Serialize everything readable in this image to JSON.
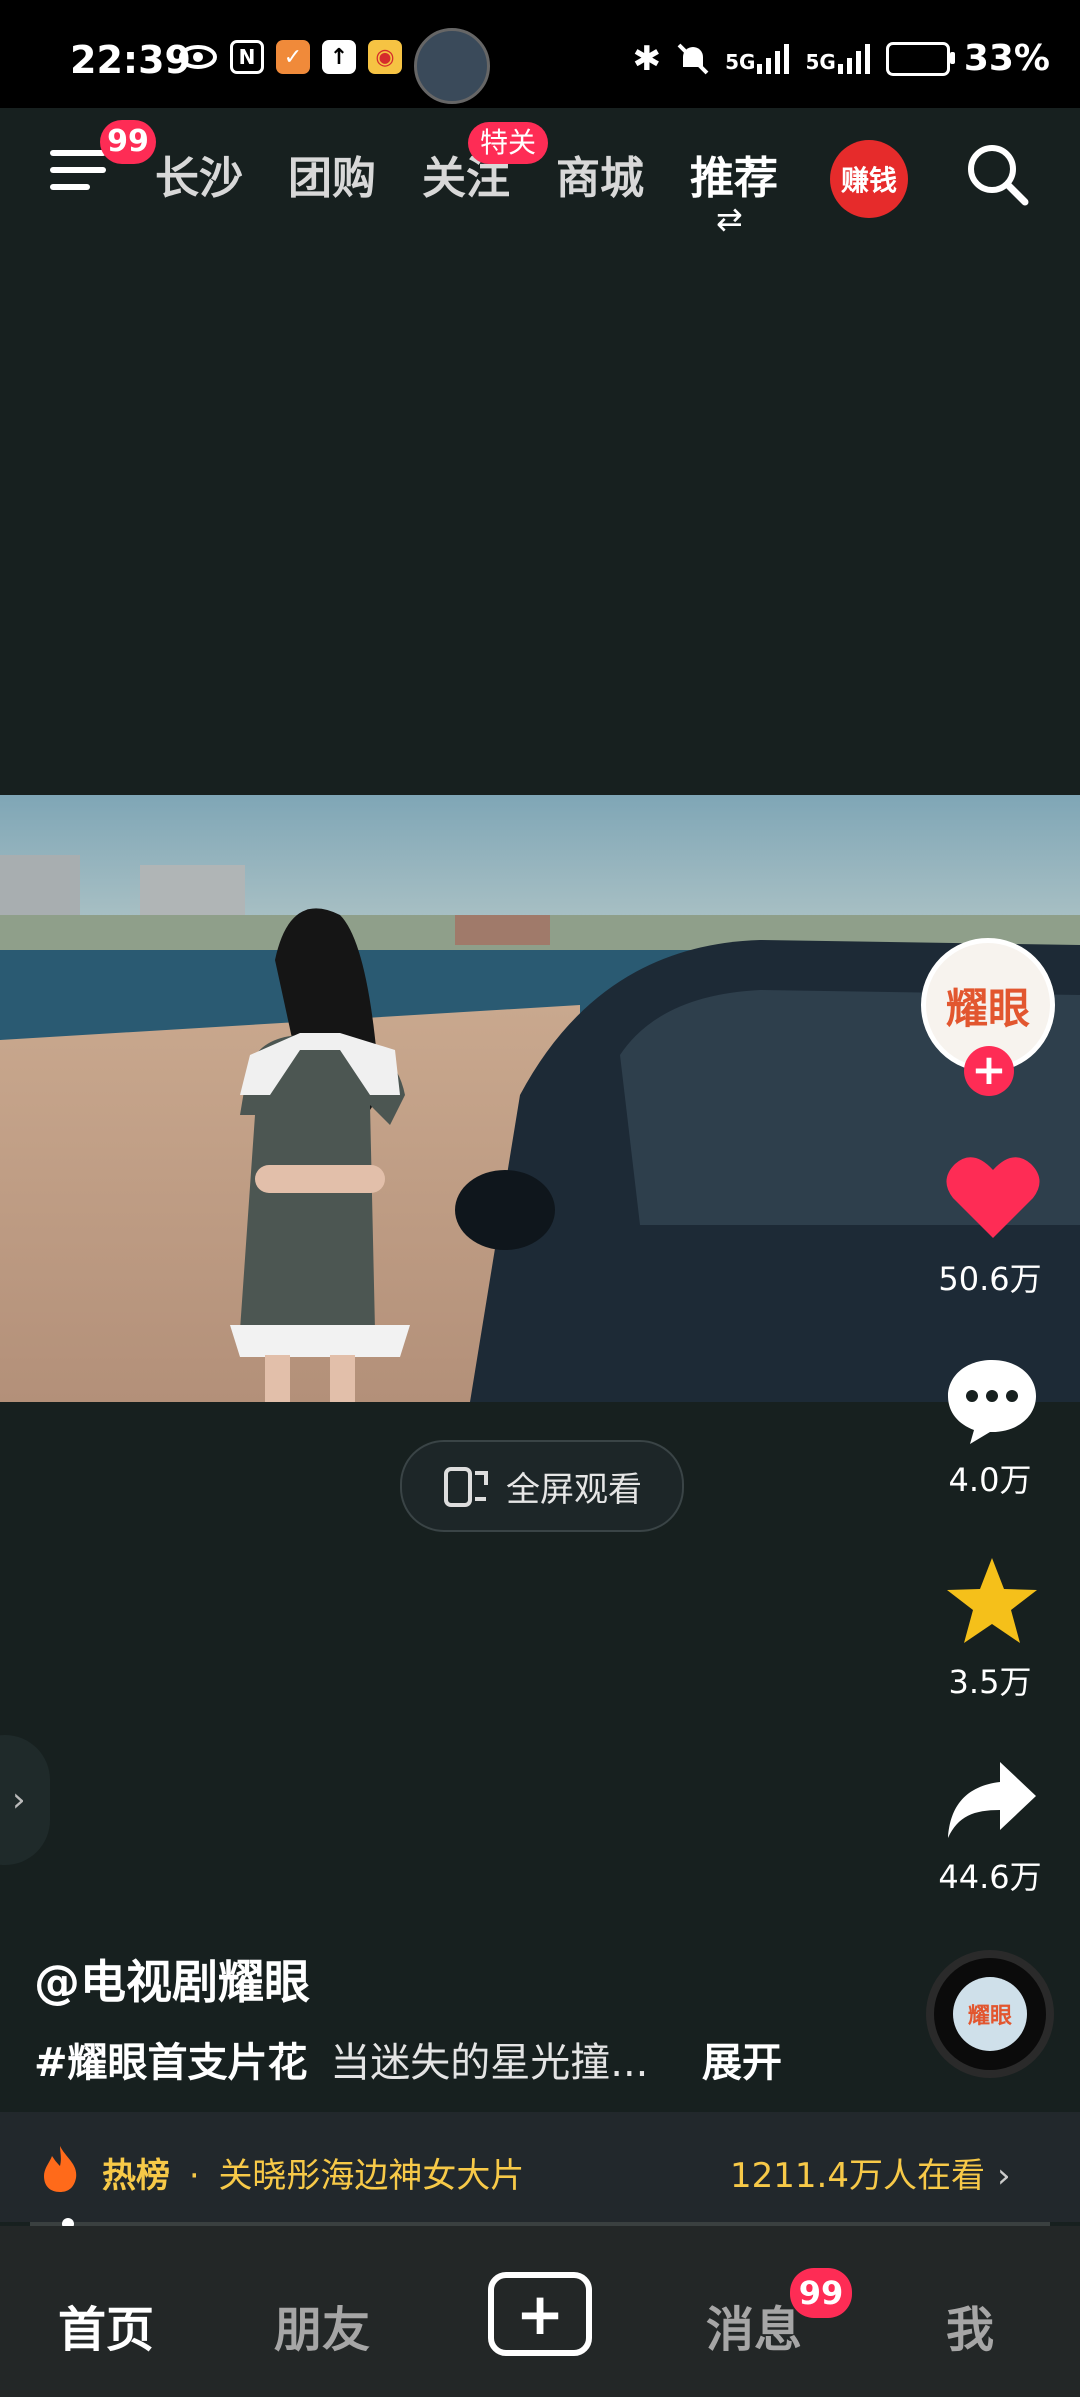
{
  "status_bar": {
    "time": "22:39",
    "network_1": "5G",
    "network_2": "5G",
    "battery": "33%"
  },
  "top_nav": {
    "menu_badge": "99",
    "tabs": [
      "长沙",
      "团购",
      "关注",
      "商城",
      "推荐"
    ],
    "follow_badge": "特关",
    "earn_label": "赚钱"
  },
  "video": {
    "fullscreen_label": "全屏观看"
  },
  "rail": {
    "avatar_text": "耀眼",
    "likes": "50.6万",
    "comments": "4.0万",
    "favorites": "3.5万",
    "shares": "44.6万"
  },
  "caption": {
    "author": "@电视剧耀眼",
    "hashtag": "#耀眼首支片花",
    "text": "当迷失的星光撞...",
    "expand": "展开"
  },
  "hot_bar": {
    "label": "热榜",
    "dot": "·",
    "title": "关晓彤海边神女大片",
    "viewers": "1211.4万人在看"
  },
  "tab_bar": {
    "home": "首页",
    "friends": "朋友",
    "messages": "消息",
    "messages_badge": "99",
    "me": "我"
  },
  "colors": {
    "accent": "#fe2c55",
    "background": "#17201f",
    "star": "#f5c01a",
    "hot_text": "#f7c948"
  }
}
